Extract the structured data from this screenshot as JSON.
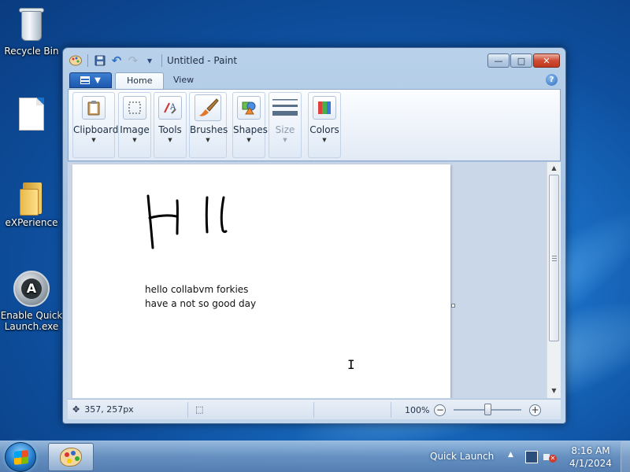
{
  "desktop": {
    "icons": [
      {
        "label": "Recycle Bin",
        "icon": "recycle-bin-icon"
      },
      {
        "label": "",
        "icon": "file-icon"
      },
      {
        "label": "eXPerience",
        "icon": "folder-icon"
      },
      {
        "label": "Enable Quick Launch.exe",
        "icon": "quick-launch-app-icon"
      }
    ]
  },
  "window": {
    "title": "Untitled - Paint",
    "caption": {
      "minimize": "—",
      "maximize": "□",
      "close": "✕"
    },
    "qat": {
      "save": "▪",
      "undo": "↶",
      "redo": "↷",
      "more": "▾"
    },
    "tabs": [
      {
        "label": "Home",
        "active": true
      },
      {
        "label": "View",
        "active": false
      }
    ],
    "help": "?",
    "ribbon_groups": [
      {
        "label": "Clipboard",
        "icon": "clipboard-icon",
        "enabled": true
      },
      {
        "label": "Image",
        "icon": "image-select-icon",
        "enabled": true
      },
      {
        "label": "Tools",
        "icon": "tools-icon",
        "enabled": true
      },
      {
        "label": "Brushes",
        "icon": "brush-icon",
        "enabled": true
      },
      {
        "label": "Shapes",
        "icon": "shapes-icon",
        "enabled": true
      },
      {
        "label": "Size",
        "icon": "size-icon",
        "enabled": false
      },
      {
        "label": "Colors",
        "icon": "colors-icon",
        "enabled": true
      }
    ],
    "canvas": {
      "drawing": "Hi",
      "text_lines": [
        "hello collabvm forkies",
        "have a not so good day"
      ]
    },
    "status": {
      "cursor_position": "357, 257px",
      "zoom": "100%",
      "zoom_out": "−",
      "zoom_in": "+",
      "zoom_fraction": 0.5
    }
  },
  "taskbar": {
    "quick_launch_label": "Quick Launch",
    "tray_arrow": "▲",
    "time": "8:16 AM",
    "date": "4/1/2024"
  },
  "colors": {
    "titlebar": "#b9d1ea",
    "file_tab": "#1c58b0",
    "close_button": "#c0391f",
    "taskbar": "#6e96c3"
  }
}
